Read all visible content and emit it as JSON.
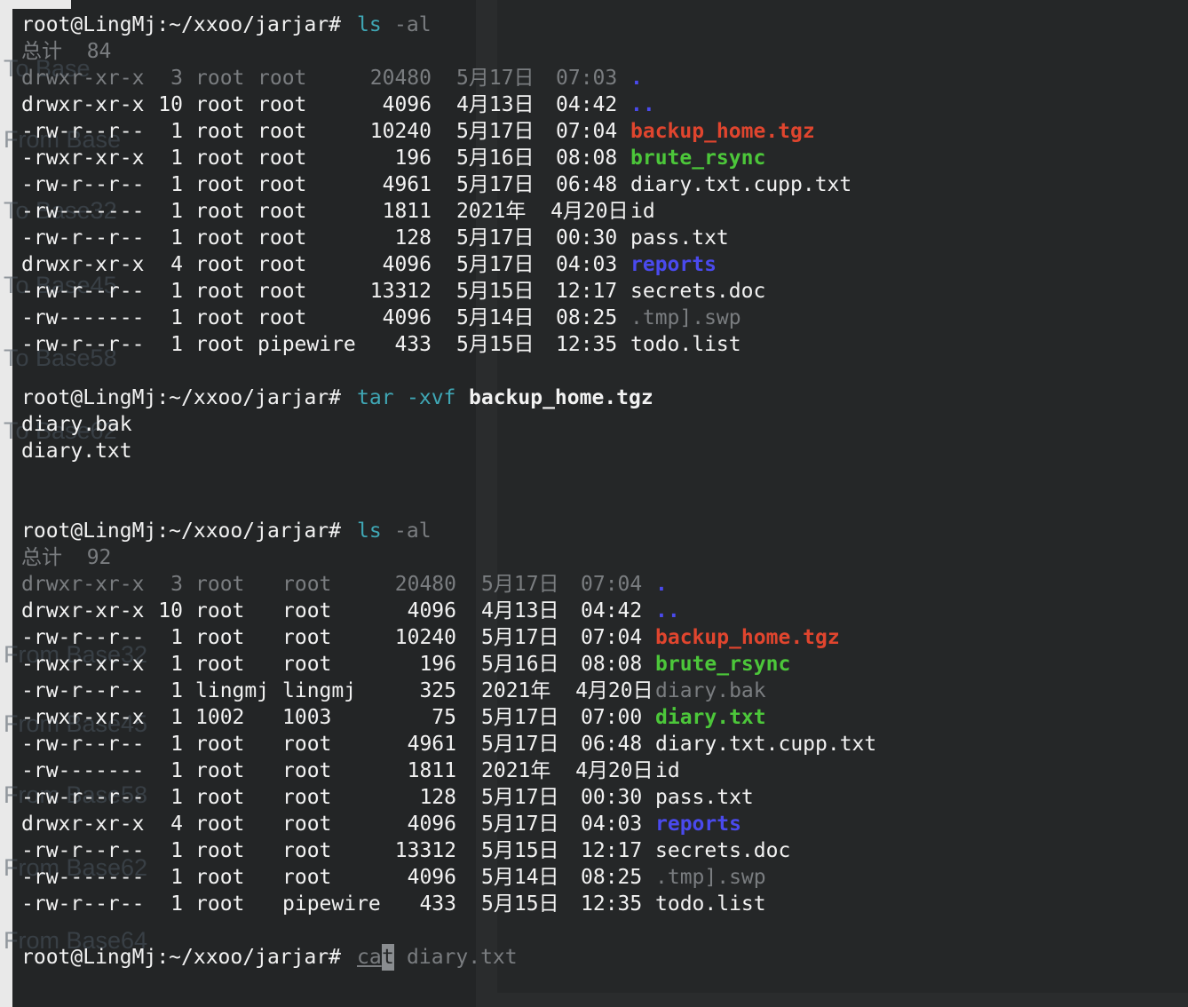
{
  "prompt": "root@LingMj:~/xxoo/jarjar#",
  "commands": {
    "ls1": {
      "cmd": "ls",
      "arg": "-al"
    },
    "tar": {
      "cmd": "tar",
      "flags": "-xvf",
      "file": "backup_home.tgz"
    },
    "ls2": {
      "cmd": "ls",
      "arg": "-al"
    },
    "cat": {
      "cmd_typed": "ca",
      "cursor_char": "t",
      "arg": "diary.txt"
    }
  },
  "listing1": {
    "total": "总计  84",
    "rows": [
      {
        "perm": "drwxr-xr-x",
        "links": "3",
        "owner": "root",
        "group": "root",
        "size": "20480",
        "month": "5月17日",
        "time": "07:03",
        "name": ".",
        "style": "blue",
        "dim": true
      },
      {
        "perm": "drwxr-xr-x",
        "links": "10",
        "owner": "root",
        "group": "root",
        "size": "4096",
        "month": "4月13日",
        "time": "04:42",
        "name": "..",
        "style": "blue"
      },
      {
        "perm": "-rw-r--r--",
        "links": "1",
        "owner": "root",
        "group": "root",
        "size": "10240",
        "month": "5月17日",
        "time": "07:04",
        "name": "backup_home.tgz",
        "style": "red"
      },
      {
        "perm": "-rwxr-xr-x",
        "links": "1",
        "owner": "root",
        "group": "root",
        "size": "196",
        "month": "5月16日",
        "time": "08:08",
        "name": "brute_rsync",
        "style": "green"
      },
      {
        "perm": "-rw-r--r--",
        "links": "1",
        "owner": "root",
        "group": "root",
        "size": "4961",
        "month": "5月17日",
        "time": "06:48",
        "name": "diary.txt.cupp.txt",
        "style": "plain"
      },
      {
        "perm": "-rw-------",
        "links": "1",
        "owner": "root",
        "group": "root",
        "size": "1811",
        "month": "2021年  4月20日",
        "time": "",
        "name": "id",
        "style": "plain"
      },
      {
        "perm": "-rw-r--r--",
        "links": "1",
        "owner": "root",
        "group": "root",
        "size": "128",
        "month": "5月17日",
        "time": "00:30",
        "name": "pass.txt",
        "style": "plain"
      },
      {
        "perm": "drwxr-xr-x",
        "links": "4",
        "owner": "root",
        "group": "root",
        "size": "4096",
        "month": "5月17日",
        "time": "04:03",
        "name": "reports",
        "style": "blue"
      },
      {
        "perm": "-rw-r--r--",
        "links": "1",
        "owner": "root",
        "group": "root",
        "size": "13312",
        "month": "5月15日",
        "time": "12:17",
        "name": "secrets.doc",
        "style": "plain"
      },
      {
        "perm": "-rw-------",
        "links": "1",
        "owner": "root",
        "group": "root",
        "size": "4096",
        "month": "5月14日",
        "time": "08:25",
        "name": ".tmp].swp",
        "style": "gray"
      },
      {
        "perm": "-rw-r--r--",
        "links": "1",
        "owner": "root",
        "group": "pipewire",
        "size": "433",
        "month": "5月15日",
        "time": "12:35",
        "name": "todo.list",
        "style": "plain"
      }
    ]
  },
  "tar_output": [
    "diary.bak",
    "diary.txt"
  ],
  "listing2": {
    "total": "总计  92",
    "rows": [
      {
        "perm": "drwxr-xr-x",
        "links": "3",
        "owner": "root",
        "group": "root",
        "size": "20480",
        "month": "5月17日",
        "time": "07:04",
        "name": ".",
        "style": "blue",
        "dim": true
      },
      {
        "perm": "drwxr-xr-x",
        "links": "10",
        "owner": "root",
        "group": "root",
        "size": "4096",
        "month": "4月13日",
        "time": "04:42",
        "name": "..",
        "style": "blue"
      },
      {
        "perm": "-rw-r--r--",
        "links": "1",
        "owner": "root",
        "group": "root",
        "size": "10240",
        "month": "5月17日",
        "time": "07:04",
        "name": "backup_home.tgz",
        "style": "red"
      },
      {
        "perm": "-rwxr-xr-x",
        "links": "1",
        "owner": "root",
        "group": "root",
        "size": "196",
        "month": "5月16日",
        "time": "08:08",
        "name": "brute_rsync",
        "style": "green"
      },
      {
        "perm": "-rw-r--r--",
        "links": "1",
        "owner": "lingmj",
        "group": "lingmj",
        "size": "325",
        "month": "2021年  4月20日",
        "time": "",
        "name": "diary.bak",
        "style": "gray"
      },
      {
        "perm": "-rwxr-xr-x",
        "links": "1",
        "owner": "1002",
        "group": "1003",
        "size": "75",
        "month": "5月17日",
        "time": "07:00",
        "name": "diary.txt",
        "style": "green"
      },
      {
        "perm": "-rw-r--r--",
        "links": "1",
        "owner": "root",
        "group": "root",
        "size": "4961",
        "month": "5月17日",
        "time": "06:48",
        "name": "diary.txt.cupp.txt",
        "style": "plain"
      },
      {
        "perm": "-rw-------",
        "links": "1",
        "owner": "root",
        "group": "root",
        "size": "1811",
        "month": "2021年  4月20日",
        "time": "",
        "name": "id",
        "style": "plain"
      },
      {
        "perm": "-rw-r--r--",
        "links": "1",
        "owner": "root",
        "group": "root",
        "size": "128",
        "month": "5月17日",
        "time": "00:30",
        "name": "pass.txt",
        "style": "plain"
      },
      {
        "perm": "drwxr-xr-x",
        "links": "4",
        "owner": "root",
        "group": "root",
        "size": "4096",
        "month": "5月17日",
        "time": "04:03",
        "name": "reports",
        "style": "blue"
      },
      {
        "perm": "-rw-r--r--",
        "links": "1",
        "owner": "root",
        "group": "root",
        "size": "13312",
        "month": "5月15日",
        "time": "12:17",
        "name": "secrets.doc",
        "style": "plain"
      },
      {
        "perm": "-rw-------",
        "links": "1",
        "owner": "root",
        "group": "root",
        "size": "4096",
        "month": "5月14日",
        "time": "08:25",
        "name": ".tmp].swp",
        "style": "gray"
      },
      {
        "perm": "-rw-r--r--",
        "links": "1",
        "owner": "root",
        "group": "pipewire",
        "size": "433",
        "month": "5月15日",
        "time": "12:35",
        "name": "todo.list",
        "style": "plain"
      }
    ]
  },
  "background_labels": [
    "To Base",
    "From Base",
    "To Base32",
    "To Base45",
    "To Base58",
    "To Base62",
    "From Base32",
    "From Base45",
    "From Base58",
    "From Base62",
    "From Base64"
  ]
}
